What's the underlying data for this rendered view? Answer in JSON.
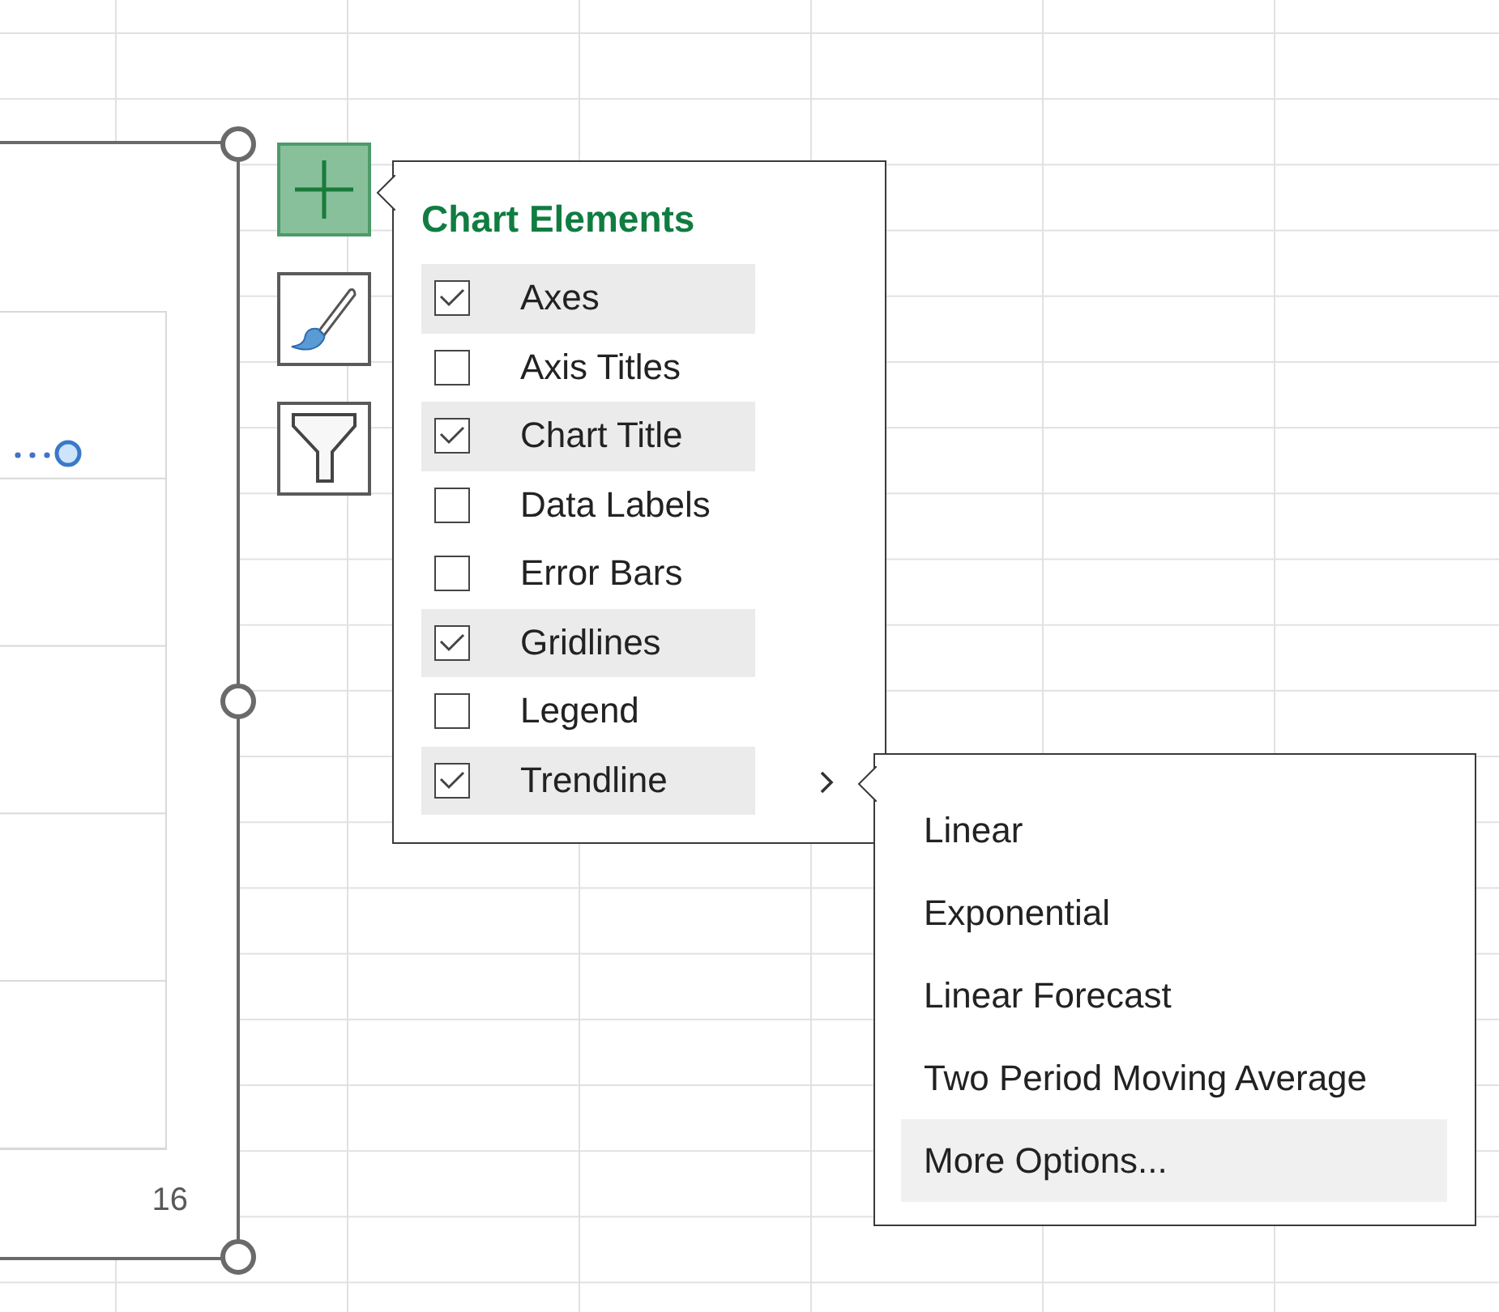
{
  "chart": {
    "axis_label": "16"
  },
  "toolbar": [
    {
      "kind": "add",
      "selected": true
    },
    {
      "kind": "style",
      "selected": false
    },
    {
      "kind": "filter",
      "selected": false
    }
  ],
  "chart_elements": {
    "title": "Chart Elements",
    "items": [
      {
        "label": "Axes",
        "checked": true,
        "has_submenu": false
      },
      {
        "label": "Axis Titles",
        "checked": false,
        "has_submenu": false
      },
      {
        "label": "Chart Title",
        "checked": true,
        "has_submenu": false
      },
      {
        "label": "Data Labels",
        "checked": false,
        "has_submenu": false
      },
      {
        "label": "Error Bars",
        "checked": false,
        "has_submenu": false
      },
      {
        "label": "Gridlines",
        "checked": true,
        "has_submenu": false
      },
      {
        "label": "Legend",
        "checked": false,
        "has_submenu": false
      },
      {
        "label": "Trendline",
        "checked": true,
        "has_submenu": true
      }
    ]
  },
  "trendline_menu": {
    "items": [
      {
        "label": "Linear",
        "selected": false
      },
      {
        "label": "Exponential",
        "selected": false
      },
      {
        "label": "Linear Forecast",
        "selected": false
      },
      {
        "label": "Two Period Moving Average",
        "selected": false
      },
      {
        "label": "More Options...",
        "selected": true
      }
    ]
  }
}
